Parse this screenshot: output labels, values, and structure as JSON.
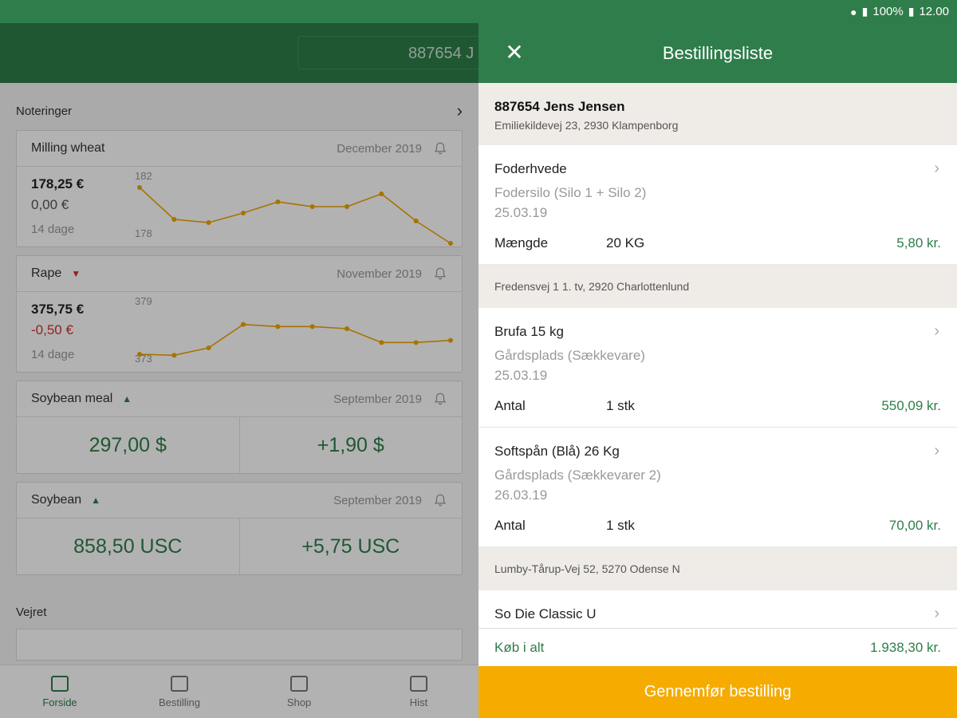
{
  "status_bar": {
    "battery": "100%",
    "time": "12.00",
    "icons": [
      "location-icon",
      "signal-icon",
      "battery-icon"
    ]
  },
  "background": {
    "search_value": "887654 J",
    "notes_title": "Noteringer",
    "cards": [
      {
        "name": "Milling wheat",
        "trend": "",
        "month": "December 2019",
        "price": "178,25 €",
        "change": "0,00 €",
        "change_negative": false,
        "period": "14 dage",
        "y_max": "182",
        "y_min": "178",
        "series": [
          181.2,
          179.2,
          179.0,
          179.6,
          180.3,
          180.0,
          180.0,
          180.8,
          179.1,
          177.7
        ]
      },
      {
        "name": "Rape",
        "trend": "down",
        "month": "November 2019",
        "price": "375,75 €",
        "change": "-0,50 €",
        "change_negative": true,
        "period": "14 dage",
        "y_max": "379",
        "y_min": "373",
        "series": [
          373.9,
          373.8,
          374.5,
          376.7,
          376.5,
          376.5,
          376.3,
          375.0,
          375.0,
          375.2
        ]
      },
      {
        "name": "Soybean meal",
        "trend": "up",
        "month": "September 2019",
        "value": "297,00 $",
        "change": "+1,90 $"
      },
      {
        "name": "Soybean",
        "trend": "up",
        "month": "September 2019",
        "value": "858,50 USC",
        "change": "+5,75 USC"
      }
    ],
    "weather_title": "Vejret",
    "nav": [
      {
        "label": "Forside",
        "active": true
      },
      {
        "label": "Bestilling",
        "active": false
      },
      {
        "label": "Shop",
        "active": false
      },
      {
        "label": "Hist",
        "active": false
      }
    ]
  },
  "drawer": {
    "title": "Bestillingsliste",
    "customer": {
      "name": "887654 Jens Jensen",
      "address": "Emiliekildevej 23, 2930 Klampenborg"
    },
    "items": [
      {
        "name": "Foderhvede",
        "location": "Fodersilo (Silo 1 + Silo 2)",
        "date": "25.03.19",
        "qty_label": "Mængde",
        "qty": "20 KG",
        "price": "5,80 kr."
      }
    ],
    "sep1": "Fredensvej 1 1. tv, 2920 Charlottenlund",
    "items2": [
      {
        "name": "Brufa 15 kg",
        "location": "Gårdsplads (Sækkevare)",
        "date": "25.03.19",
        "qty_label": "Antal",
        "qty": "1 stk",
        "price": "550,09 kr."
      },
      {
        "name": "Softspån (Blå) 26 Kg",
        "location": "Gårdsplads (Sækkevarer 2)",
        "date": "26.03.19",
        "qty_label": "Antal",
        "qty": "1 stk",
        "price": "70,00 kr."
      }
    ],
    "sep2": "Lumby-Tårup-Vej 52, 5270 Odense N",
    "partial_item": "So Die Classic U",
    "total_label": "Køb i alt",
    "total_value": "1.938,30 kr.",
    "cta": "Gennemfør bestilling"
  }
}
